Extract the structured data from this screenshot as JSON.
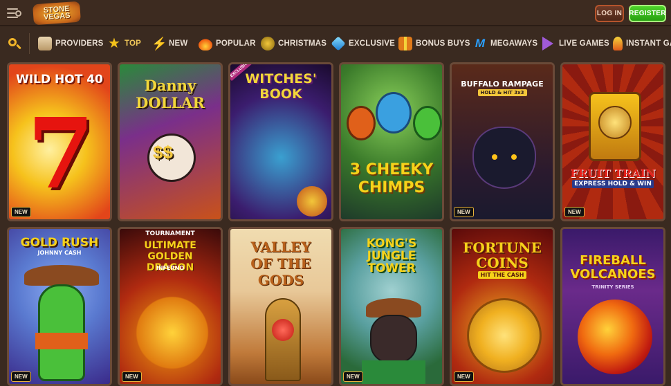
{
  "header": {
    "logo_text": "STONE VEGAS",
    "login_label": "LOG IN",
    "register_label": "REGISTER"
  },
  "categories": [
    {
      "label": "PROVIDERS",
      "icon": "scroll-icon",
      "active": false
    },
    {
      "label": "TOP",
      "icon": "star-icon",
      "active": true
    },
    {
      "label": "NEW",
      "icon": "lightning-icon",
      "active": false
    },
    {
      "label": "POPULAR",
      "icon": "fire-icon",
      "active": false
    },
    {
      "label": "CHRISTMAS",
      "icon": "ornament-icon",
      "active": false
    },
    {
      "label": "EXCLUSIVE",
      "icon": "diamond-icon",
      "active": false
    },
    {
      "label": "BONUS BUYS",
      "icon": "gift-icon",
      "active": false
    },
    {
      "label": "MEGAWAYS",
      "icon": "megaways-icon",
      "active": false
    },
    {
      "label": "LIVE GAMES",
      "icon": "play-icon",
      "active": false
    },
    {
      "label": "INSTANT GAMES",
      "icon": "rocket-icon",
      "active": false
    }
  ],
  "games": [
    {
      "title": "WILD HOT 40",
      "subtitle": "",
      "badge": "NEW",
      "colors": [
        "#f6c21c",
        "#e2451a"
      ]
    },
    {
      "title": "Danny DOLLAR",
      "subtitle": "",
      "badge": "",
      "colors": [
        "#7a2f8a",
        "#c9521a"
      ]
    },
    {
      "title": "WITCHES' BOOK",
      "subtitle": "",
      "badge": "",
      "tag": "EXCLUSIVE",
      "colors": [
        "#3b1d6e",
        "#1a5a7a"
      ]
    },
    {
      "title": "3 CHEEKY CHIMPS",
      "subtitle": "",
      "badge": "",
      "colors": [
        "#3a7a2a",
        "#1e3a2a"
      ]
    },
    {
      "title": "BUFFALO RAMPAGE",
      "subtitle": "HOLD & HIT 3x3",
      "badge": "NEW",
      "colors": [
        "#5a2a1a",
        "#1a1a2e"
      ]
    },
    {
      "title": "FRUIT TRAIN",
      "subtitle": "EXPRESS HOLD & WIN",
      "badge": "NEW",
      "colors": [
        "#8a1a10",
        "#f0a020"
      ]
    },
    {
      "title": "GOLD RUSH",
      "subtitle": "JOHNNY CASH",
      "badge": "NEW",
      "colors": [
        "#3a2a8a",
        "#5a7ad0"
      ]
    },
    {
      "title": "ULTIMATE GOLDEN DRAGON",
      "subtitle": "INFERNO",
      "badge": "NEW",
      "tag": "TOURNAMENT",
      "colors": [
        "#6a0a0a",
        "#f08a10"
      ]
    },
    {
      "title": "VALLEY OF THE GODS",
      "subtitle": "",
      "badge": "",
      "colors": [
        "#e8c898",
        "#b8601a"
      ]
    },
    {
      "title": "KONG'S JUNGLE TOWER",
      "subtitle": "",
      "badge": "NEW",
      "colors": [
        "#2a6a3a",
        "#5aa0a0"
      ]
    },
    {
      "title": "FORTUNE COINS",
      "subtitle": "HIT THE CASH",
      "badge": "NEW",
      "colors": [
        "#8a0a0a",
        "#f0b020"
      ]
    },
    {
      "title": "FIREBALL VOLCANOES",
      "subtitle": "TRINITY SERIES",
      "badge": "",
      "colors": [
        "#3a1a6a",
        "#e04a10"
      ]
    }
  ],
  "accent": "#f1c85a",
  "register_color": "#27a011"
}
